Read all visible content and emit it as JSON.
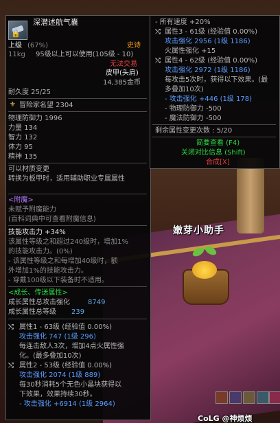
{
  "item": {
    "name": "深潜述航气囊",
    "grade": "上级",
    "grade_pct": "(67%)",
    "rarity": "史诗",
    "weight": "11kg",
    "level_req": "95级以上可以使用(105级 - 10)",
    "trade": "无法交易",
    "slot": "皮甲(头肩)",
    "price": "14,385金币",
    "durability": "耐久度 25/25",
    "adventure": "冒险家名望 2304",
    "stats": [
      "物理防御力 1996",
      "力量 134",
      "智力 132",
      "体力 95",
      "精神 135"
    ],
    "material_change": "可以材质变更",
    "convert": "转换为板甲时，适用辅助职业专属属性",
    "enchant_title": "<附魔>",
    "enchant_none": "未赋予附魔能力",
    "enchant_hint": "(百科词典中可查看附魔信息)",
    "skill_attack": "技能攻击力 +34%",
    "skill_desc": [
      "该属性等级之和超过240级时，增加1%",
      "的技能攻击力。(0%)",
      "- 该属性等级之和每增加40级时，额",
      "外增加1%的技能攻击力。",
      "- 穿戴100级以下装备时不适用。"
    ],
    "growth_title": "<成长、传送属性>",
    "growth_attack_label": "成长属性总攻击强化",
    "growth_attack_value": "8749",
    "growth_level_label": "成长属性总等级",
    "growth_level_value": "239",
    "attr1_title": "属性1 - 63级 (经验值 0.00%)",
    "attr1_atk": "攻击强化 747 (1级 296)",
    "attr1_desc": [
      "每连击敌人3次，增加4点火属性强",
      "化。(最多叠加10次)"
    ],
    "attr2_title": "属性2 - 53级 (经验值 0.00%)",
    "attr2_atk": "攻击强化 2074 (1级 889)",
    "attr2_desc": [
      "每30秒消耗5个无色小晶块获得以",
      "下效果，效果持续30秒。"
    ],
    "attr2_bonus": "- 攻击强化 +6914 (1级 2964)"
  },
  "right": {
    "speed": "- 所有速度 +20%",
    "attr3_title": "属性3 - 61级 (经验值 0.00%)",
    "attr3_atk": "攻击强化 2956 (1级 1186)",
    "attr3_desc": "火属性强化 +15",
    "attr4_title": "属性4 - 62级 (经验值 0.00%)",
    "attr4_atk": "攻击强化 2972 (1级 1186)",
    "attr4_desc": [
      "每攻击5次时，获得以下效果。(最",
      "多叠加10次)"
    ],
    "attr4_bonus": [
      "- 攻击强化 +446 (1级 178)",
      "- 物理防御力 -500",
      "- 魔法防御力 -500"
    ],
    "remaining": "剩余属性变更次数 : 5/20",
    "brief": "简要查看 (F4)",
    "close_compare": "关闭对比信息 (Shift)",
    "synthesize": "合成[X]"
  },
  "scene": {
    "helper_title": "嫩芽小助手",
    "watermark": "CoLG @神烦烦"
  },
  "colors": {
    "epic": "#f0a020",
    "untradable": "#e04040",
    "growth": "#2ad844",
    "attack_value": "#5a9cff"
  }
}
